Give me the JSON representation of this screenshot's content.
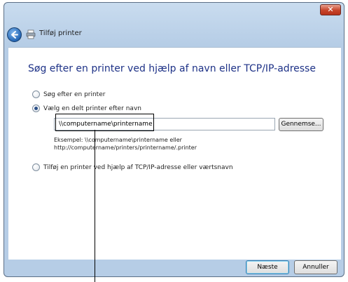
{
  "window": {
    "title": "Tilføj printer",
    "close_symbol": "✕"
  },
  "main": {
    "heading": "Søg efter en printer ved hjælp af navn eller TCP/IP-adresse",
    "options": [
      {
        "label": "Søg efter en printer",
        "checked": false
      },
      {
        "label": "Vælg en delt printer efter navn",
        "checked": true
      },
      {
        "label": "Tilføj en printer ved hjælp af TCP/IP-adresse eller værtsnavn",
        "checked": false
      }
    ],
    "printer_name_value": "\\\\computername\\printername",
    "browse_label": "Gennemse...",
    "example_line1": "Eksempel: \\\\computername\\printername eller",
    "example_line2": "http://computername/printers/printername/.printer"
  },
  "footer": {
    "next_label": "Næste",
    "cancel_label": "Annuller"
  },
  "icons": {
    "back": "back-arrow-icon",
    "printer": "printer-icon"
  }
}
